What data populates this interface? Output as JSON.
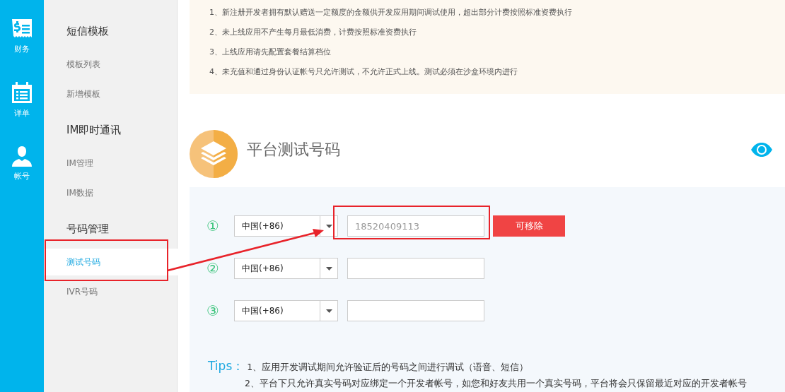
{
  "rail": [
    {
      "kind": "finance",
      "label": "财务"
    },
    {
      "kind": "calendar",
      "label": "详单"
    },
    {
      "kind": "person",
      "label": "帐号"
    }
  ],
  "sidebar": {
    "groups": [
      {
        "title": "短信模板",
        "items": [
          {
            "label": "模板列表",
            "selected": false,
            "highlighted": false
          },
          {
            "label": "新增模板",
            "selected": false,
            "highlighted": false
          }
        ]
      },
      {
        "title": "IM即时通讯",
        "items": [
          {
            "label": "IM管理",
            "selected": false,
            "highlighted": false
          },
          {
            "label": "IM数据",
            "selected": false,
            "highlighted": false
          }
        ]
      },
      {
        "title": "号码管理",
        "items": [
          {
            "label": "测试号码",
            "selected": true,
            "highlighted": true
          },
          {
            "label": "IVR号码",
            "selected": false,
            "highlighted": false
          }
        ]
      }
    ]
  },
  "notice": [
    "1、新注册开发者拥有默认赠送一定额度的金额供开发应用期间调试使用，超出部分计费按照标准资费执行",
    "2、未上线应用不产生每月最低消费，计费按照标准资费执行",
    "3、上线应用请先配置套餐结算档位",
    "4、未充值和通过身份认证帐号只允许测试，不允许正式上线。测试必须在沙盒环境内进行"
  ],
  "section": {
    "title": "平台测试号码"
  },
  "phone_rows": [
    {
      "index": "①",
      "country": "中国(+86)",
      "value": "18520409113",
      "button": "可移除",
      "highlighted": true
    },
    {
      "index": "②",
      "country": "中国(+86)",
      "highlighted": false
    },
    {
      "index": "③",
      "country": "中国(+86)",
      "highlighted": false
    }
  ],
  "pointer_arrow": true,
  "tips": {
    "label": "Tips：",
    "lines": [
      "1、应用开发调试期间允许验证后的号码之间进行调试（语音、短信）",
      "2、平台下只允许真实号码对应绑定一个开发者帐号，如您和好友共用一个真实号码，平台将会只保留最近对应的开发者帐号"
    ]
  }
}
